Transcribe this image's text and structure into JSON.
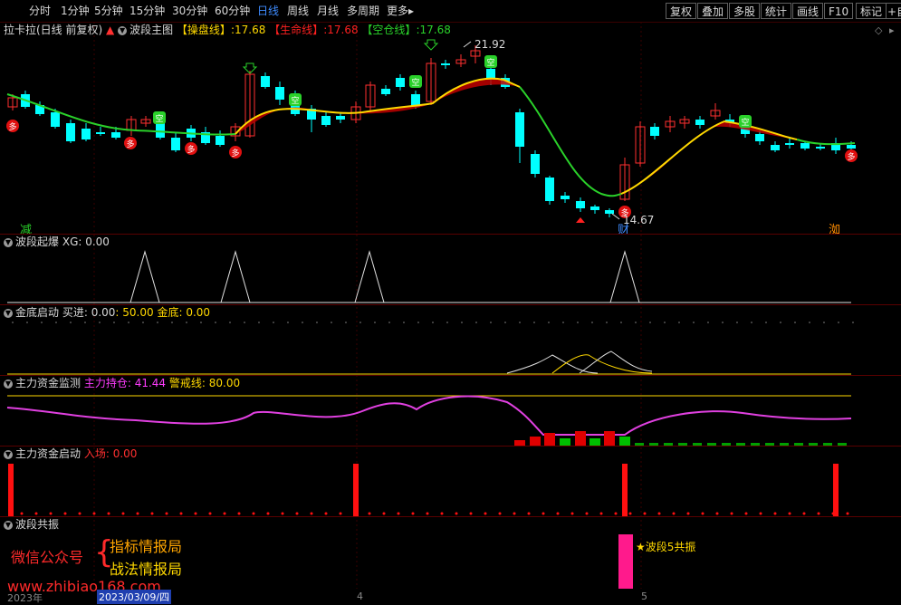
{
  "toolbar": {
    "periods": [
      "分时",
      "1分钟",
      "5分钟",
      "15分钟",
      "30分钟",
      "60分钟",
      "日线",
      "周线",
      "月线",
      "多周期",
      "更多▸"
    ],
    "active": "日线",
    "right_buttons": [
      "复权",
      "叠加",
      "多股",
      "统计",
      "画线",
      "F10",
      "标记",
      "+自"
    ]
  },
  "main_panel": {
    "stock_name": "拉卡拉(日线 前复权)",
    "indicator_name": "波段主图",
    "lines": [
      {
        "label": "【操盘线】",
        "value": "17.68",
        "color": "#ffd800"
      },
      {
        "label": "【生命线】",
        "value": "17.68",
        "color": "#ff2020"
      },
      {
        "label": "【空仓线】",
        "value": "17.68",
        "color": "#2ad12a"
      }
    ],
    "high_label": "21.92",
    "low_label": "14.67",
    "left_marker": "减",
    "right_marker": "洳",
    "cai_marker": "财"
  },
  "panel_boduan": {
    "title": "波段起爆",
    "field": "XG: 0.00"
  },
  "panel_jindi": {
    "title": "金底启动",
    "field_buy": "买进: 0.00",
    "field_val": ": 50.00",
    "field_jindi": "金底: 0.00"
  },
  "panel_zhuli": {
    "title": "主力资金监测",
    "field_hold": "主力持仓: 41.44",
    "field_warn": "警戒线: 80.00"
  },
  "panel_zhuli_start": {
    "title": "主力资金启动",
    "field": "入场: 0.00"
  },
  "panel_gongzhen": {
    "title": "波段共振",
    "label": "★波段5共振"
  },
  "watermark": {
    "wechat": "微信公众号",
    "line1": "指标情报局",
    "line2": "战法情报局",
    "site": "www.zhibiao168.com"
  },
  "date_axis": {
    "year": "2023年",
    "cursor_date": "2023/03/09/四",
    "m4": "4",
    "m5": "5"
  },
  "colors": {
    "up": "#ff3030",
    "down": "#00ffff",
    "bg": "#000000",
    "accent": "#3f8cff"
  },
  "chart_data": {
    "type": "candlestick",
    "high": 21.92,
    "low": 14.67,
    "series": [
      {
        "name": "操盘线",
        "value": 17.68
      },
      {
        "name": "生命线",
        "value": 17.68
      },
      {
        "name": "空仓线",
        "value": 17.68
      },
      {
        "name": "主力持仓",
        "value": 41.44
      },
      {
        "name": "警戒线",
        "value": 80.0
      }
    ]
  }
}
